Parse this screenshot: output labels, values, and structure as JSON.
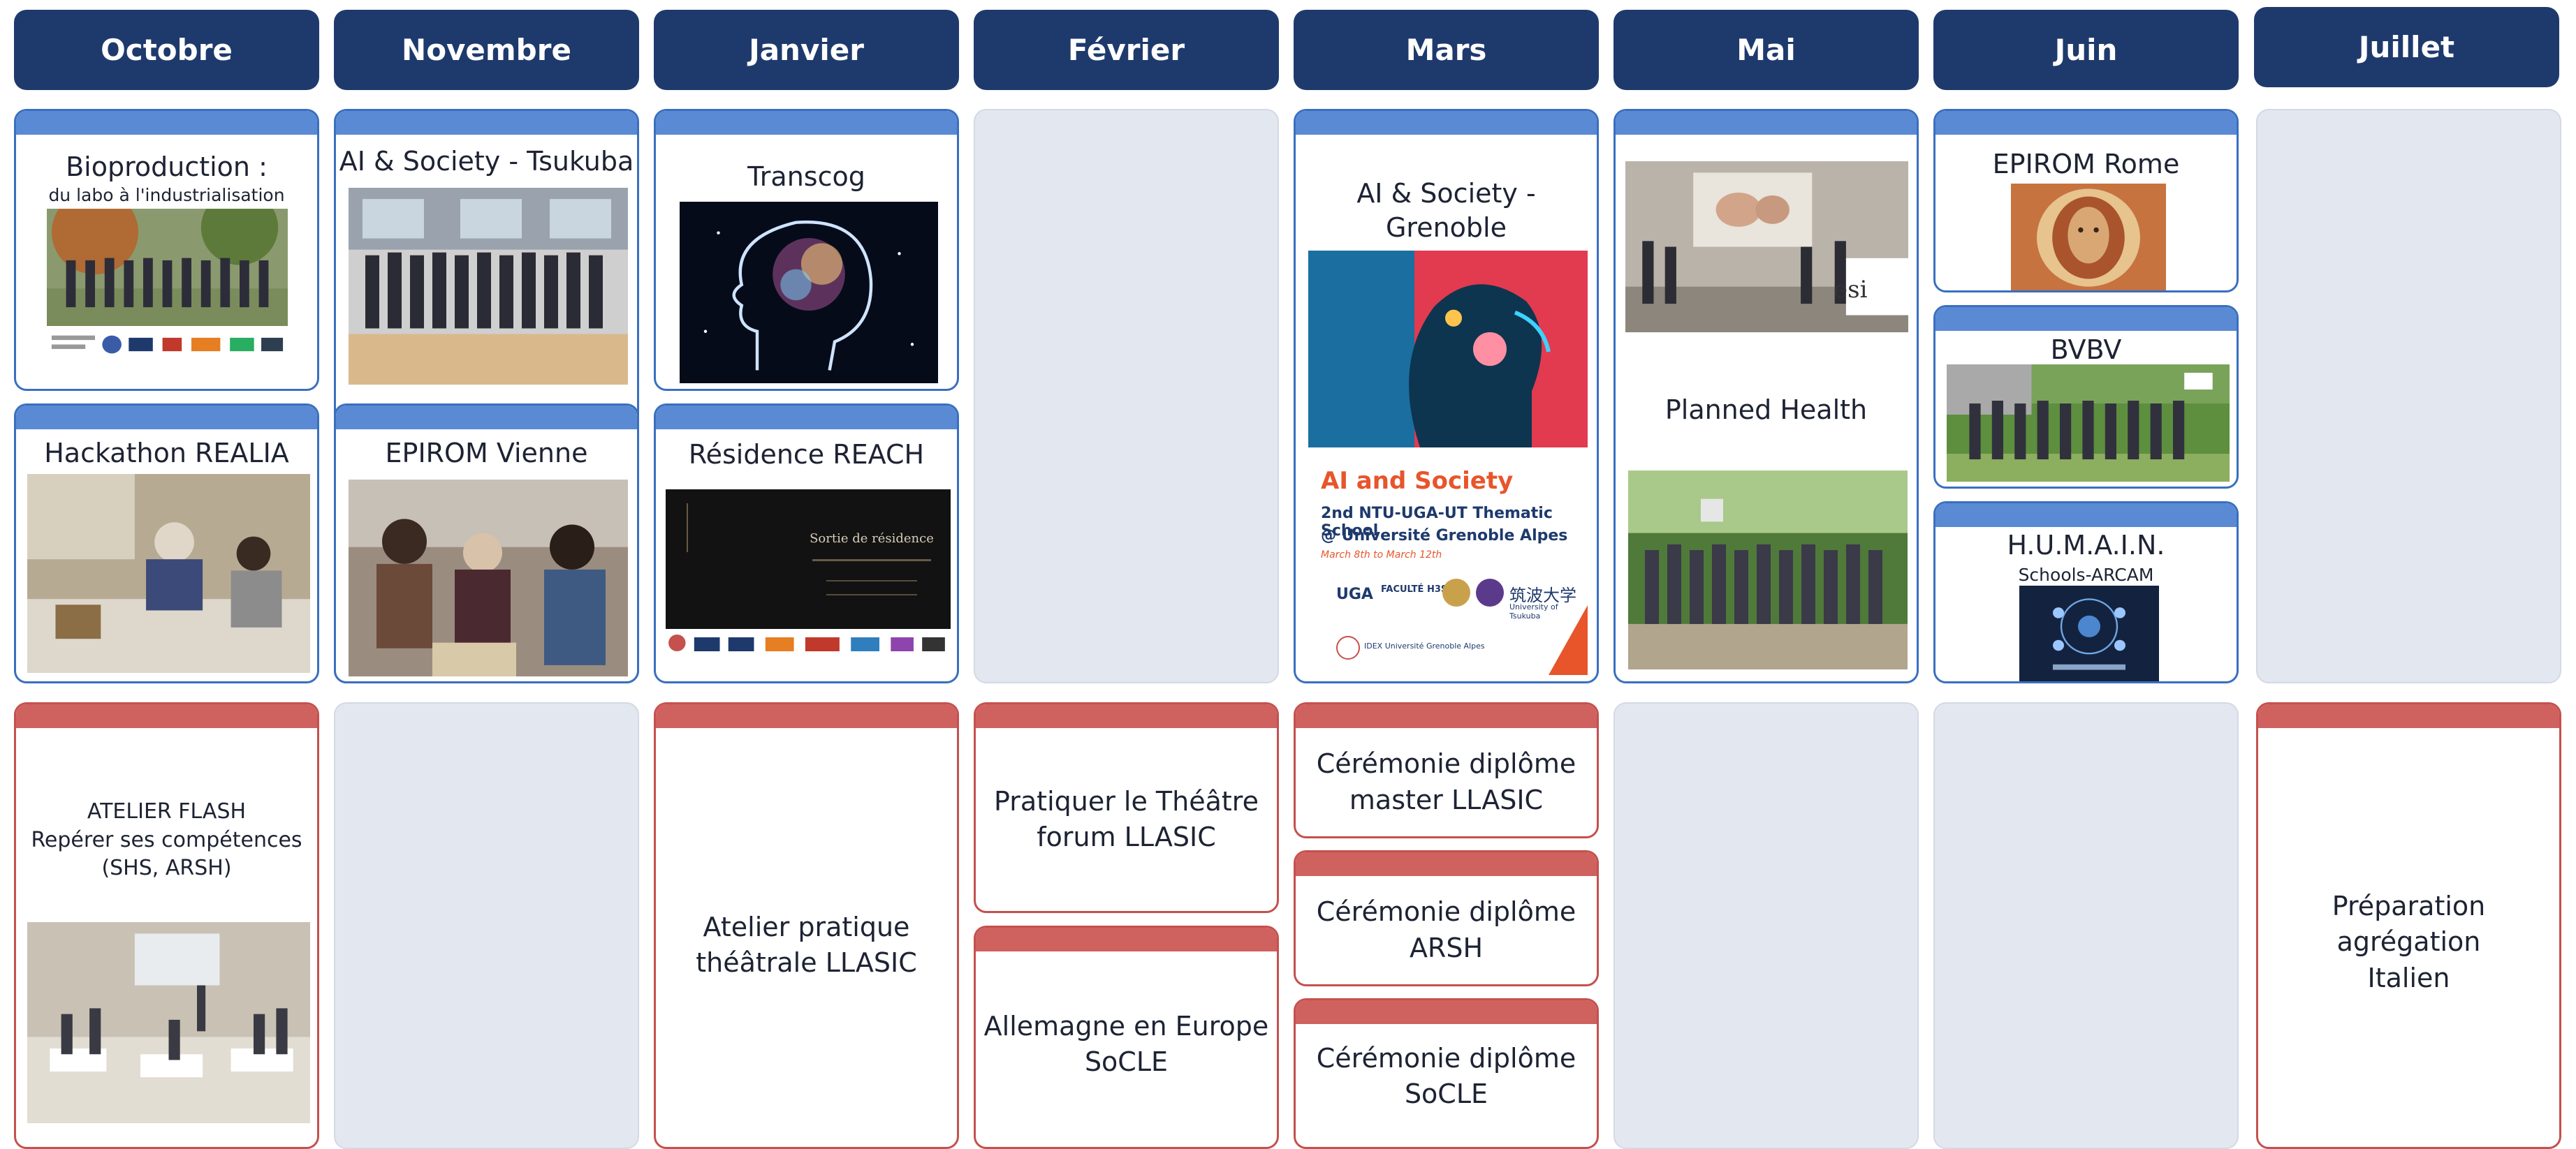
{
  "months": [
    "Octobre",
    "Novembre",
    "Janvier",
    "Février",
    "Mars",
    "Mai",
    "Juin",
    "Juillet"
  ],
  "cards": {
    "bioproduction": {
      "title": "Bioproduction :",
      "subtitle": "du labo à l'industrialisation"
    },
    "ai_tsukuba": {
      "title": "AI & Society - Tsukuba"
    },
    "transcog": {
      "title": "Transcog"
    },
    "ai_grenoble": {
      "title": "AI & Society - Grenoble",
      "poster_heading": "AI and Society",
      "poster_line1": "2nd NTU-UGA-UT Thematic School",
      "poster_line2": "@ Université Grenoble Alpes",
      "poster_dates": "March 8th to March 12th",
      "poster_uga": "UGA",
      "poster_faculte": "FACULTÉ H3S",
      "poster_tsukuba": "筑波大学",
      "poster_tsukuba_en": "University of Tsukuba",
      "poster_idex": "IDEX Université Grenoble Alpes"
    },
    "planned_health": {
      "title": "Planned Health",
      "badge": "esi"
    },
    "epirom_rome": {
      "title": "EPIROM Rome"
    },
    "bvbv": {
      "title": "BVBV"
    },
    "humain": {
      "title": "H.U.M.A.I.N.",
      "subtitle": "Schools-ARCAM"
    },
    "hackathon": {
      "title": "Hackathon REALIA"
    },
    "epirom_vienne": {
      "title": "EPIROM Vienne"
    },
    "reach": {
      "title": "Résidence REACH",
      "img_text": "Sortie de résidence"
    },
    "atelier_flash": {
      "title": "ATELIER FLASH\nRepérer ses compétences\n(SHS, ARSH)"
    },
    "atelier_theatre": {
      "title": "Atelier pratique\nthéâtrale LLASIC"
    },
    "theatre_forum": {
      "title": "Pratiquer le Théâtre\nforum LLASIC"
    },
    "allemagne": {
      "title": "Allemagne en Europe\nSoCLE"
    },
    "diplome_llasic": {
      "title": "Cérémonie diplôme\nmaster LLASIC"
    },
    "diplome_arsh": {
      "title": "Cérémonie diplôme\nARSH"
    },
    "diplome_socle": {
      "title": "Cérémonie diplôme\nSoCLE"
    },
    "agregation": {
      "title": "Préparation agrégation\nItalien"
    }
  },
  "colors": {
    "header": "#1e3a6d",
    "blue_card": "#3a6fc0",
    "red_card": "#c4514e",
    "column_bg": "#e3e7f0"
  }
}
